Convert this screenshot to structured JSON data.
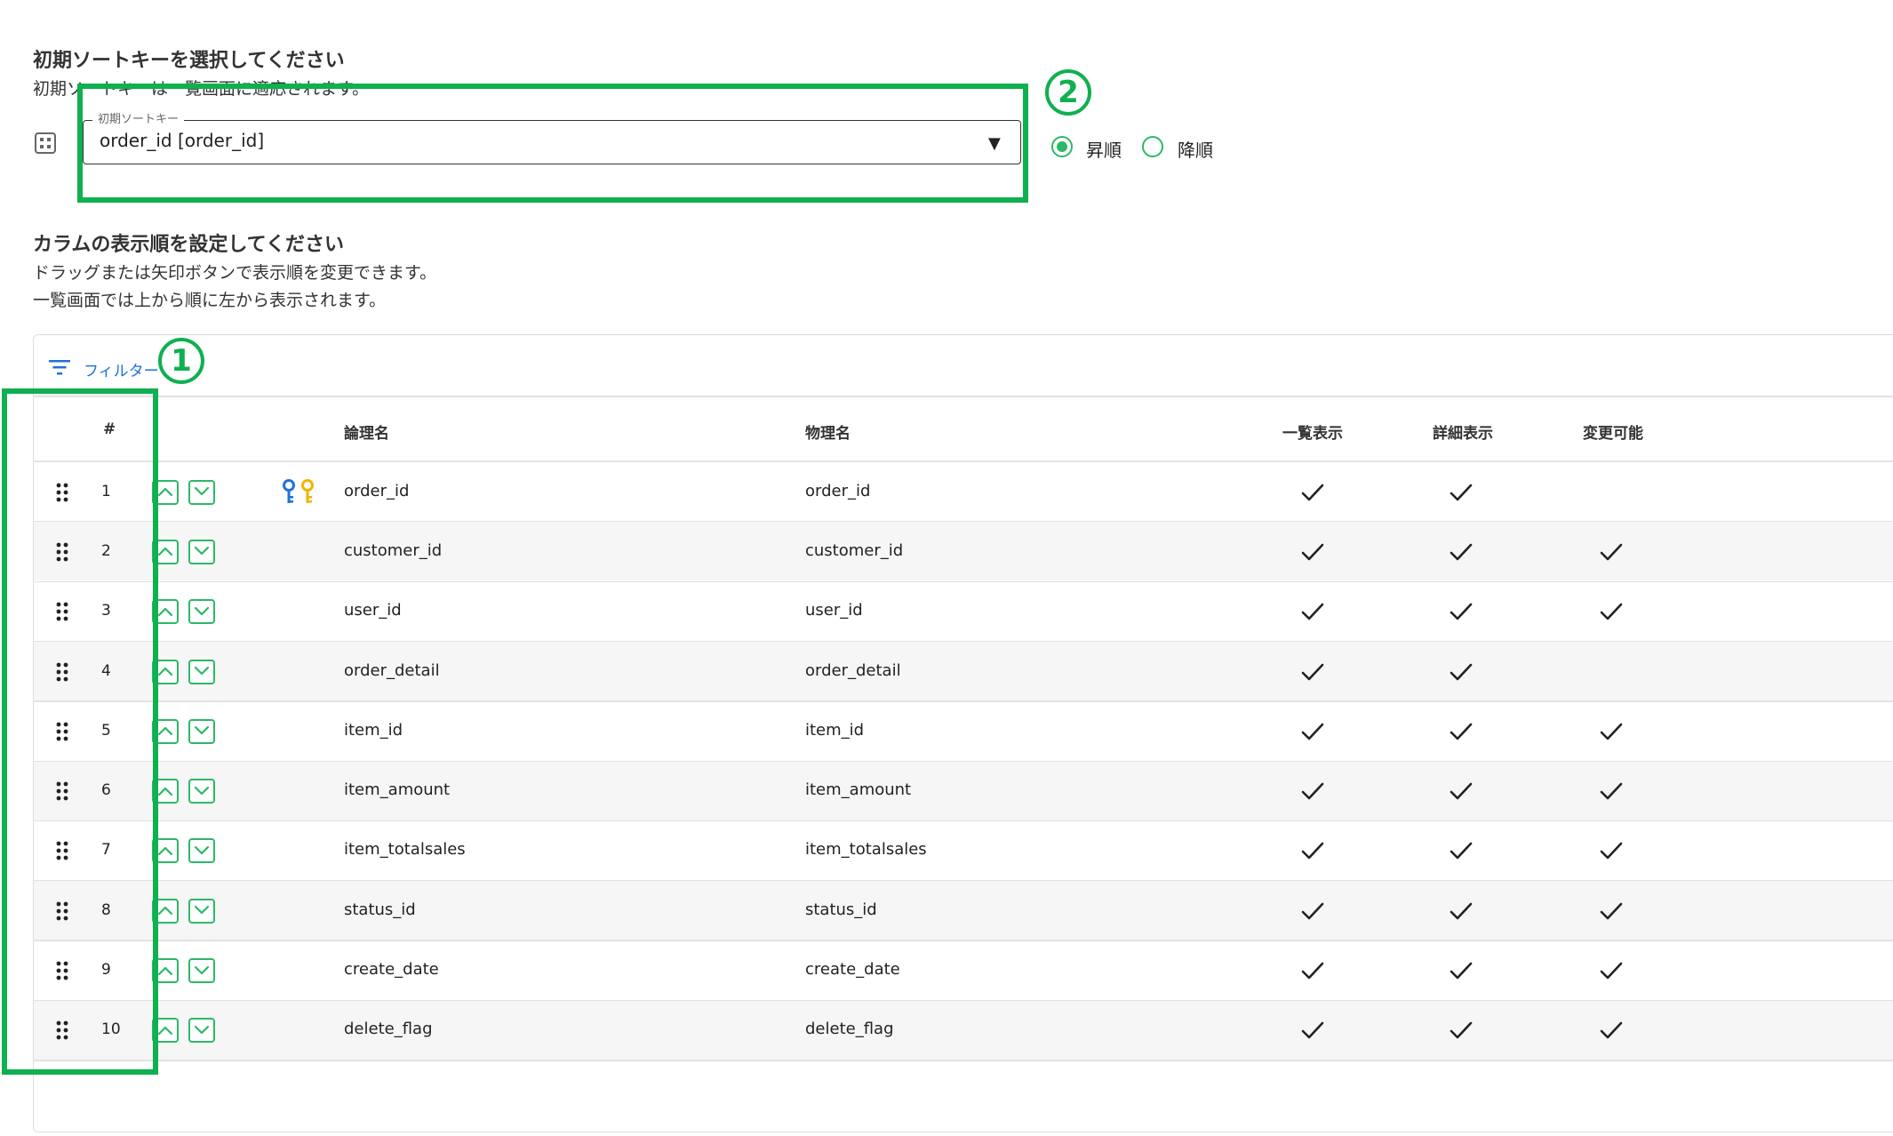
{
  "sort_key_section": {
    "title": "初期ソートキーを選択してください",
    "description": "初期ソートキーは一覧画面に適応されます。",
    "select_label": "初期ソートキー",
    "select_value": "order_id [order_id]",
    "order_options": [
      {
        "label": "昇順",
        "selected": true
      },
      {
        "label": "降順",
        "selected": false
      }
    ]
  },
  "column_section": {
    "title": "カラムの表示順を設定してください",
    "description_lines": [
      "ドラッグまたは矢印ボタンで表示順を変更できます。",
      "一覧画面では上から順に左から表示されます。"
    ]
  },
  "toolbar": {
    "filter_label": "フィルター"
  },
  "table": {
    "headers": {
      "index": "#",
      "logical_name": "論理名",
      "physical_name": "物理名",
      "list_display": "一覧表示",
      "detail_display": "詳細表示",
      "editable": "変更可能"
    },
    "rows": [
      {
        "index": "1",
        "logical": "order_id",
        "physical": "order_id",
        "key": true,
        "list": true,
        "detail": true,
        "editable": false
      },
      {
        "index": "2",
        "logical": "customer_id",
        "physical": "customer_id",
        "key": false,
        "list": true,
        "detail": true,
        "editable": true
      },
      {
        "index": "3",
        "logical": "user_id",
        "physical": "user_id",
        "key": false,
        "list": true,
        "detail": true,
        "editable": true
      },
      {
        "index": "4",
        "logical": "order_detail",
        "physical": "order_detail",
        "key": false,
        "list": true,
        "detail": true,
        "editable": false
      },
      {
        "index": "5",
        "logical": "item_id",
        "physical": "item_id",
        "key": false,
        "list": true,
        "detail": true,
        "editable": true
      },
      {
        "index": "6",
        "logical": "item_amount",
        "physical": "item_amount",
        "key": false,
        "list": true,
        "detail": true,
        "editable": true
      },
      {
        "index": "7",
        "logical": "item_totalsales",
        "physical": "item_totalsales",
        "key": false,
        "list": true,
        "detail": true,
        "editable": true
      },
      {
        "index": "8",
        "logical": "status_id",
        "physical": "status_id",
        "key": false,
        "list": true,
        "detail": true,
        "editable": true
      },
      {
        "index": "9",
        "logical": "create_date",
        "physical": "create_date",
        "key": false,
        "list": true,
        "detail": true,
        "editable": true
      },
      {
        "index": "10",
        "logical": "delete_flag",
        "physical": "delete_flag",
        "key": false,
        "list": true,
        "detail": true,
        "editable": true
      }
    ]
  },
  "annotations": {
    "first": "1",
    "second": "2"
  },
  "colors": {
    "accent_green": "#2db866",
    "annotation_green": "#0fb04f",
    "link_blue": "#1e72d8",
    "key_blue": "#1e72d8",
    "key_yellow": "#f0b400"
  }
}
